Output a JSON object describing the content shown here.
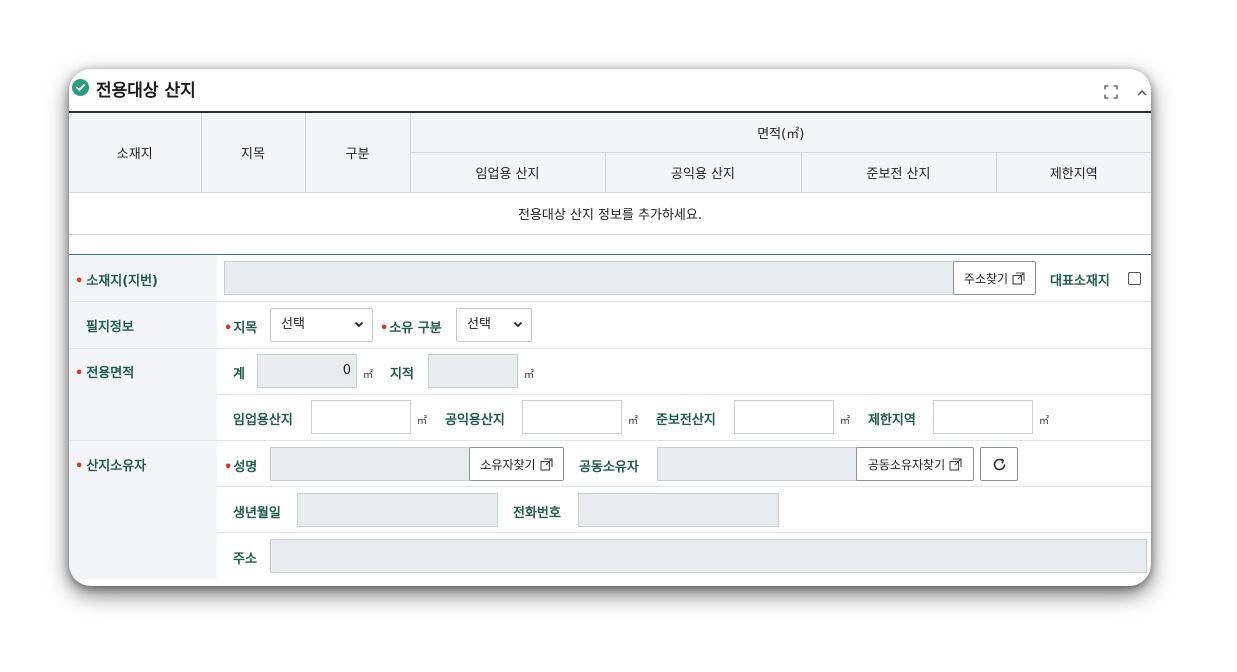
{
  "panel": {
    "title": "전용대상 산지",
    "icons": {
      "status": "check-circle-icon",
      "expand": "expand-icon",
      "collapse": "chevron-up-icon"
    },
    "accent_color": "#2a9d7c"
  },
  "summary_table": {
    "headers": {
      "location": "소재지",
      "category": "지목",
      "division": "구분",
      "area_group": "면적(㎡)",
      "sub": [
        "임업용 산지",
        "공익용 산지",
        "준보전 산지",
        "제한지역"
      ]
    },
    "empty_message": "전용대상 산지 정보를 추가하세요."
  },
  "form": {
    "location": {
      "label": "소재지(지번)",
      "value": "",
      "button": "주소찾기",
      "rep_label": "대표소재지",
      "rep_checked": false
    },
    "parcel": {
      "label": "필지정보",
      "category_label": "지목",
      "category_value": "선택",
      "ownership_label": "소유 구분",
      "ownership_value": "선택"
    },
    "area": {
      "label": "전용면적",
      "total_label": "계",
      "total_value": "0",
      "unit": "㎡",
      "register_label": "지적",
      "register_value": "",
      "forestry_label": "임업용산지",
      "public_label": "공익용산지",
      "semi_label": "준보전산지",
      "restricted_label": "제한지역",
      "forestry_value": "",
      "public_value": "",
      "semi_value": "",
      "restricted_value": ""
    },
    "owner": {
      "label": "산지소유자",
      "name_label": "성명",
      "name_value": "",
      "find_owner_button": "소유자찾기",
      "co_owner_label": "공동소유자",
      "co_owner_value": "",
      "find_co_owner_button": "공동소유자찾기",
      "birth_label": "생년월일",
      "birth_value": "",
      "phone_label": "전화번호",
      "phone_value": "",
      "address_label": "주소",
      "address_value": ""
    }
  }
}
